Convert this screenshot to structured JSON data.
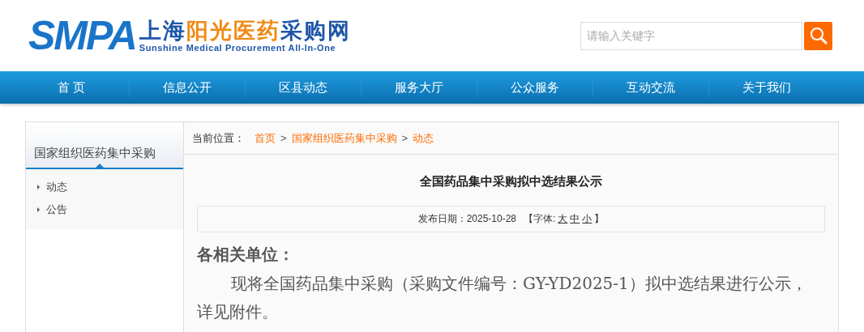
{
  "logo": {
    "mark": "SMPA",
    "title_parts": [
      {
        "text": "上海",
        "kind": "plain"
      },
      {
        "text": "阳光医药",
        "kind": "accent"
      },
      {
        "text": "采购网",
        "kind": "plain"
      }
    ],
    "subtitle": "Sunshine Medical Procurement All-In-One"
  },
  "search": {
    "placeholder": "请输入关键字"
  },
  "nav": {
    "items": [
      "首 页",
      "信息公开",
      "区县动态",
      "服务大厅",
      "公众服务",
      "互动交流",
      "关于我们"
    ]
  },
  "sidebar": {
    "title": "国家组织医药集中采购",
    "items": [
      "动态",
      "公告"
    ]
  },
  "breadcrumb": {
    "label": "当前位置：",
    "separator": ">",
    "items": [
      "首页",
      "国家组织医药集中采购",
      "动态"
    ]
  },
  "article": {
    "title": "全国药品集中采购拟中选结果公示",
    "date_label": "发布日期：",
    "date": "2025-10-28",
    "font_label": "【字体:",
    "font_sizes": [
      "大",
      "中",
      "小"
    ],
    "font_close": "】",
    "greeting": "各相关单位：",
    "body": "现将全国药品集中采购（采购文件编号：GY-YD2025-1）拟中选结果进行公示，详见附件。"
  }
}
